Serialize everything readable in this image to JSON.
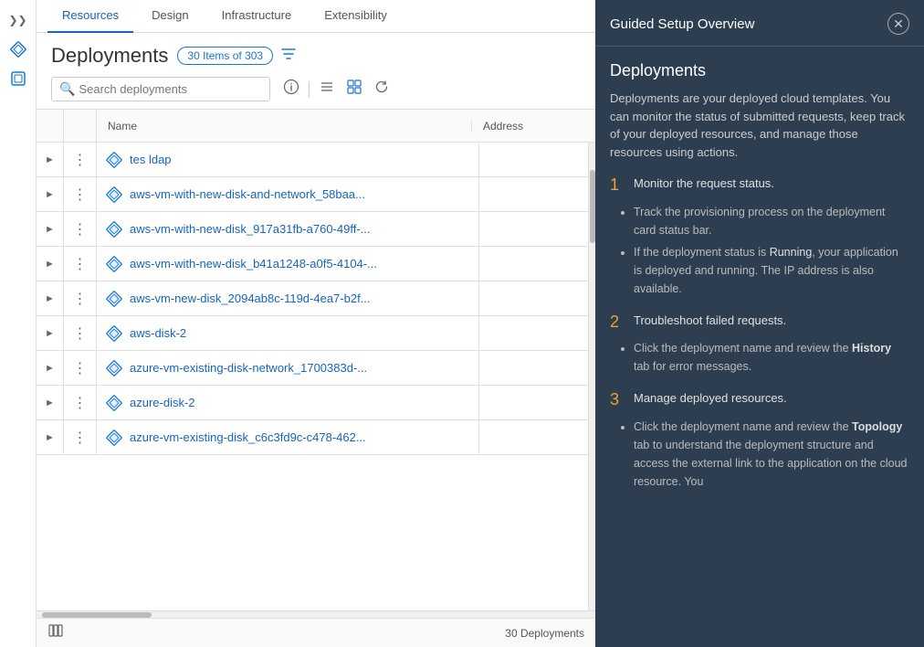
{
  "nav": {
    "tabs": [
      {
        "label": "Resources",
        "active": true
      },
      {
        "label": "Design",
        "active": false
      },
      {
        "label": "Infrastructure",
        "active": false
      },
      {
        "label": "Extensibility",
        "active": false
      }
    ]
  },
  "sidebar": {
    "chevron": "❯",
    "icon1": "◈",
    "icon2": "□"
  },
  "deployments": {
    "title": "Deployments",
    "badge": "30 Items of 303",
    "search_placeholder": "Search deployments",
    "columns": {
      "name": "Name",
      "address": "Address"
    },
    "rows": [
      {
        "name": "tes ldap"
      },
      {
        "name": "aws-vm-with-new-disk-and-network_58baa..."
      },
      {
        "name": "aws-vm-with-new-disk_917a31fb-a760-49ff-..."
      },
      {
        "name": "aws-vm-with-new-disk_b41a1248-a0f5-4104-..."
      },
      {
        "name": "aws-vm-new-disk_2094ab8c-119d-4ea7-b2f..."
      },
      {
        "name": "aws-disk-2"
      },
      {
        "name": "azure-vm-existing-disk-network_1700383d-..."
      },
      {
        "name": "azure-disk-2"
      },
      {
        "name": "azure-vm-existing-disk_c6c3fd9c-c478-462..."
      }
    ],
    "footer_count": "30 Deployments"
  },
  "guided_setup": {
    "header_title": "Guided Setup Overview",
    "section_title": "Deployments",
    "description": "Deployments are your deployed cloud templates. You can monitor the status of submitted requests, keep track of your deployed resources, and manage those resources using actions.",
    "steps": [
      {
        "number": "1",
        "title": "Monitor the request status.",
        "bullets": [
          "Track the provisioning process on the deployment card status bar.",
          "If the deployment status is Running, your application is deployed and running. The IP address is also available."
        ]
      },
      {
        "number": "2",
        "title": "Troubleshoot failed requests.",
        "bullets": [
          "Click the deployment name and review the **History** tab for error messages."
        ]
      },
      {
        "number": "3",
        "title": "Manage deployed resources.",
        "bullets": [
          "Click the deployment name and review the **Topology** tab to understand the deployment structure and access the external link to the application on the cloud resource. You"
        ]
      }
    ]
  }
}
